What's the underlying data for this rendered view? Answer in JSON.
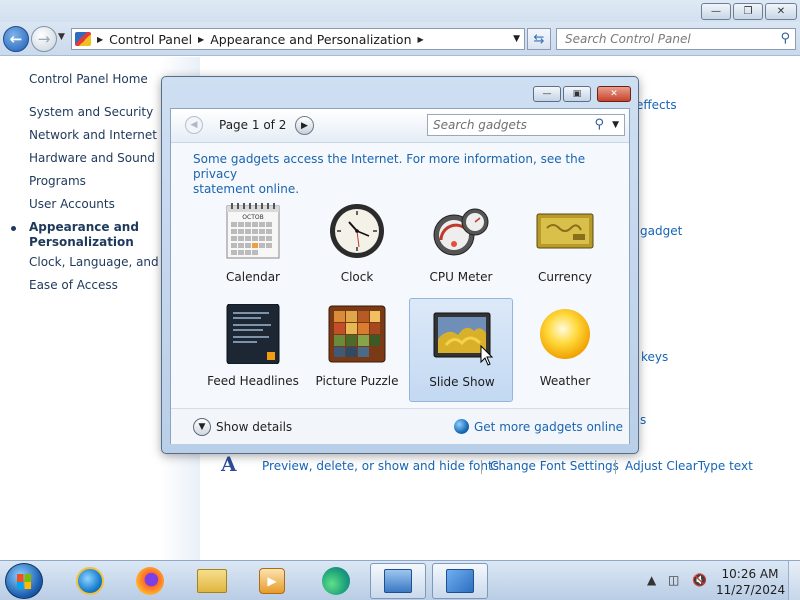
{
  "control_panel": {
    "address": {
      "crumbs": [
        "Control Panel",
        "Appearance and Personalization"
      ]
    },
    "search_placeholder": "Search Control Panel",
    "left_pane": {
      "home": "Control Panel Home",
      "items": [
        "System and Security",
        "Network and Internet",
        "Hardware and Sound",
        "Programs",
        "User Accounts"
      ],
      "active_line1": "Appearance and",
      "active_line2": "Personalization",
      "items_after": [
        "Clock, Language, and Re",
        "Ease of Access"
      ]
    },
    "background_links": {
      "effects": "effects",
      "gadget": "gadget",
      "keys": "keys",
      "s": "s",
      "fonts_preview": "Preview, delete, or show and hide fonts",
      "font_settings": "Change Font Settings",
      "cleartype": "Adjust ClearType text"
    }
  },
  "gadget_dialog": {
    "page_label": "Page 1 of 2",
    "search_placeholder": "Search gadgets",
    "notice_line1": "Some gadgets access the Internet.  For more information, see the privacy",
    "notice_line2": "statement online.",
    "gadgets": [
      {
        "name": "Calendar",
        "icon": "calendar-icon",
        "calendar_month": "OCTOB"
      },
      {
        "name": "Clock",
        "icon": "clock-icon"
      },
      {
        "name": "CPU Meter",
        "icon": "cpu-meter-icon"
      },
      {
        "name": "Currency",
        "icon": "currency-icon"
      },
      {
        "name": "Feed Headlines",
        "icon": "feed-headlines-icon"
      },
      {
        "name": "Picture Puzzle",
        "icon": "picture-puzzle-icon"
      },
      {
        "name": "Slide Show",
        "icon": "slide-show-icon",
        "selected": true
      },
      {
        "name": "Weather",
        "icon": "weather-icon"
      }
    ],
    "show_details": "Show details",
    "get_more": "Get more gadgets online"
  },
  "taskbar": {
    "apps": [
      "Internet Explorer",
      "Firefox",
      "Windows Explorer",
      "Media Player",
      "Edge",
      "Desktop Gadget Gallery",
      "Control Panel"
    ],
    "time": "10:26 AM",
    "date": "11/27/2024"
  }
}
